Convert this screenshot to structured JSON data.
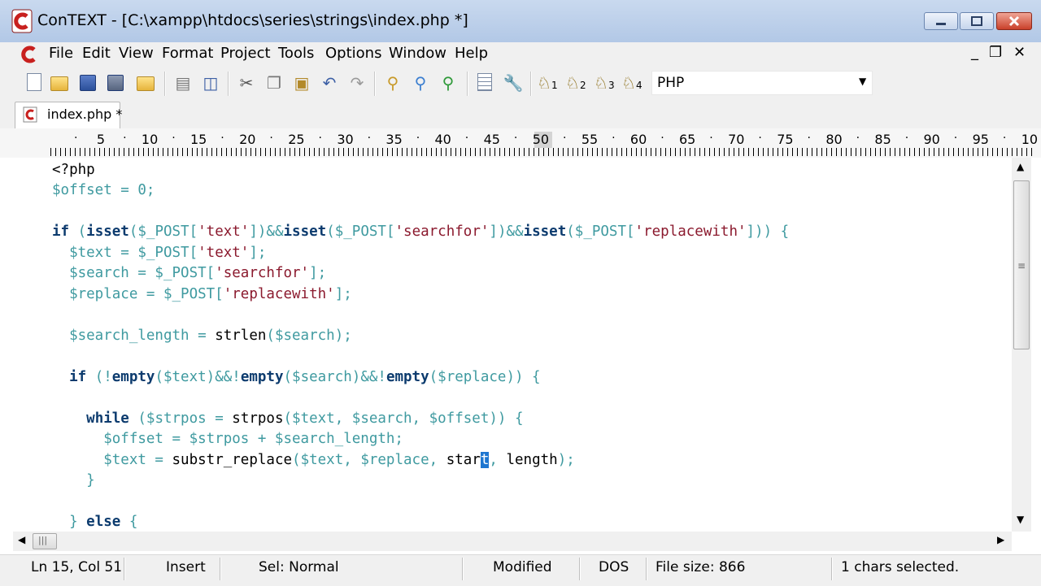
{
  "window": {
    "title": "ConTEXT - [C:\\xampp\\htdocs\\series\\strings\\index.php *]"
  },
  "menu": {
    "items": [
      "File",
      "Edit",
      "View",
      "Format",
      "Project",
      "Tools",
      "Options",
      "Window",
      "Help"
    ],
    "minimize": "_",
    "restore": "❐",
    "close": "✕"
  },
  "toolbar": {
    "language": "PHP",
    "user_commands": [
      "1",
      "2",
      "3",
      "4"
    ]
  },
  "tab": {
    "label": "index.php *"
  },
  "ruler": {
    "numbers": [
      "5",
      "10",
      "15",
      "20",
      "25",
      "30",
      "35",
      "40",
      "45",
      "50",
      "55",
      "60",
      "65",
      "70",
      "75",
      "80",
      "85",
      "90",
      "95",
      "10"
    ]
  },
  "code": {
    "lines": [
      "<?php",
      "$offset = 0;",
      "",
      "if (isset($_POST['text'])&&isset($_POST['searchfor'])&&isset($_POST['replacewith'])) {",
      "  $text = $_POST['text'];",
      "  $search = $_POST['searchfor'];",
      "  $replace = $_POST['replacewith'];",
      "",
      "  $search_length = strlen($search);",
      "",
      "  if (!empty($text)&&!empty($search)&&!empty($replace)) {",
      "",
      "    while ($strpos = strpos($text, $search, $offset)) {",
      "      $offset = $strpos + $search_length;",
      "      $text = substr_replace($text, $replace, start, length);",
      "    }",
      "",
      "  } else {"
    ]
  },
  "status": {
    "position": "Ln 15, Col 51",
    "insert_mode": "Insert",
    "selection_mode": "Sel: Normal",
    "modified": "Modified",
    "line_endings": "DOS",
    "file_size": "File size: 866",
    "selection": "1 chars selected."
  }
}
